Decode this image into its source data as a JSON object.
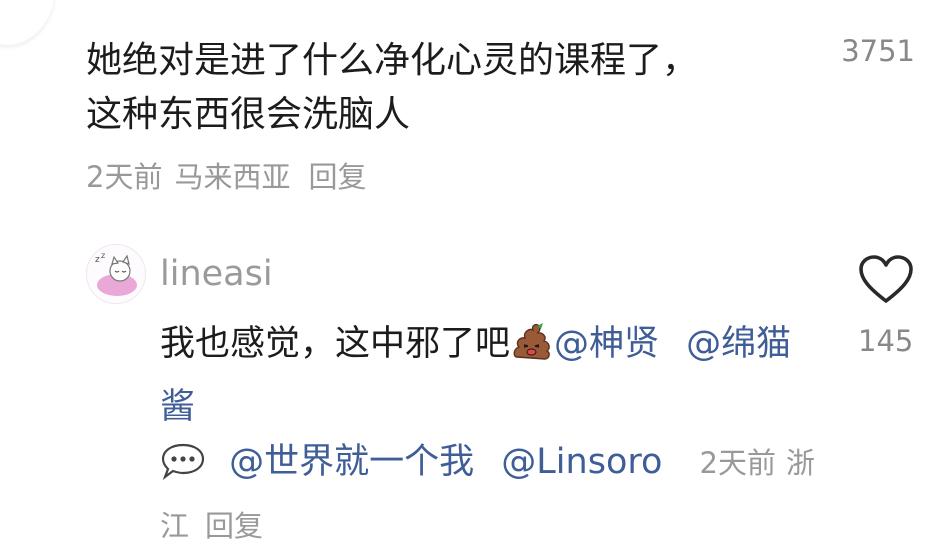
{
  "comment1": {
    "text_line1": "她绝对是进了什么净化心灵的课程了，",
    "text_line2": "这种东西很会洗脑人",
    "time": "2天前",
    "location": "马来西亚",
    "reply_label": "回复",
    "like_count": "3751"
  },
  "comment2": {
    "username": "lineasi",
    "text": "我也感觉，这中邪了吧",
    "mentions": [
      "@柛贤",
      "@绵猫酱",
      "@世界就一个我",
      "@Linsoro"
    ],
    "time": "2天前",
    "location": "浙江",
    "reply_label": "回复",
    "like_count": "145"
  },
  "icons": {
    "avatar": "sleeping-cat-avatar",
    "like": "heart-outline-icon",
    "emoji1": "poop-emoji",
    "emoji2": "speech-bubble-emoji"
  },
  "colors": {
    "text": "#1c1c1c",
    "meta": "#999999",
    "mention": "#3f5d96"
  }
}
